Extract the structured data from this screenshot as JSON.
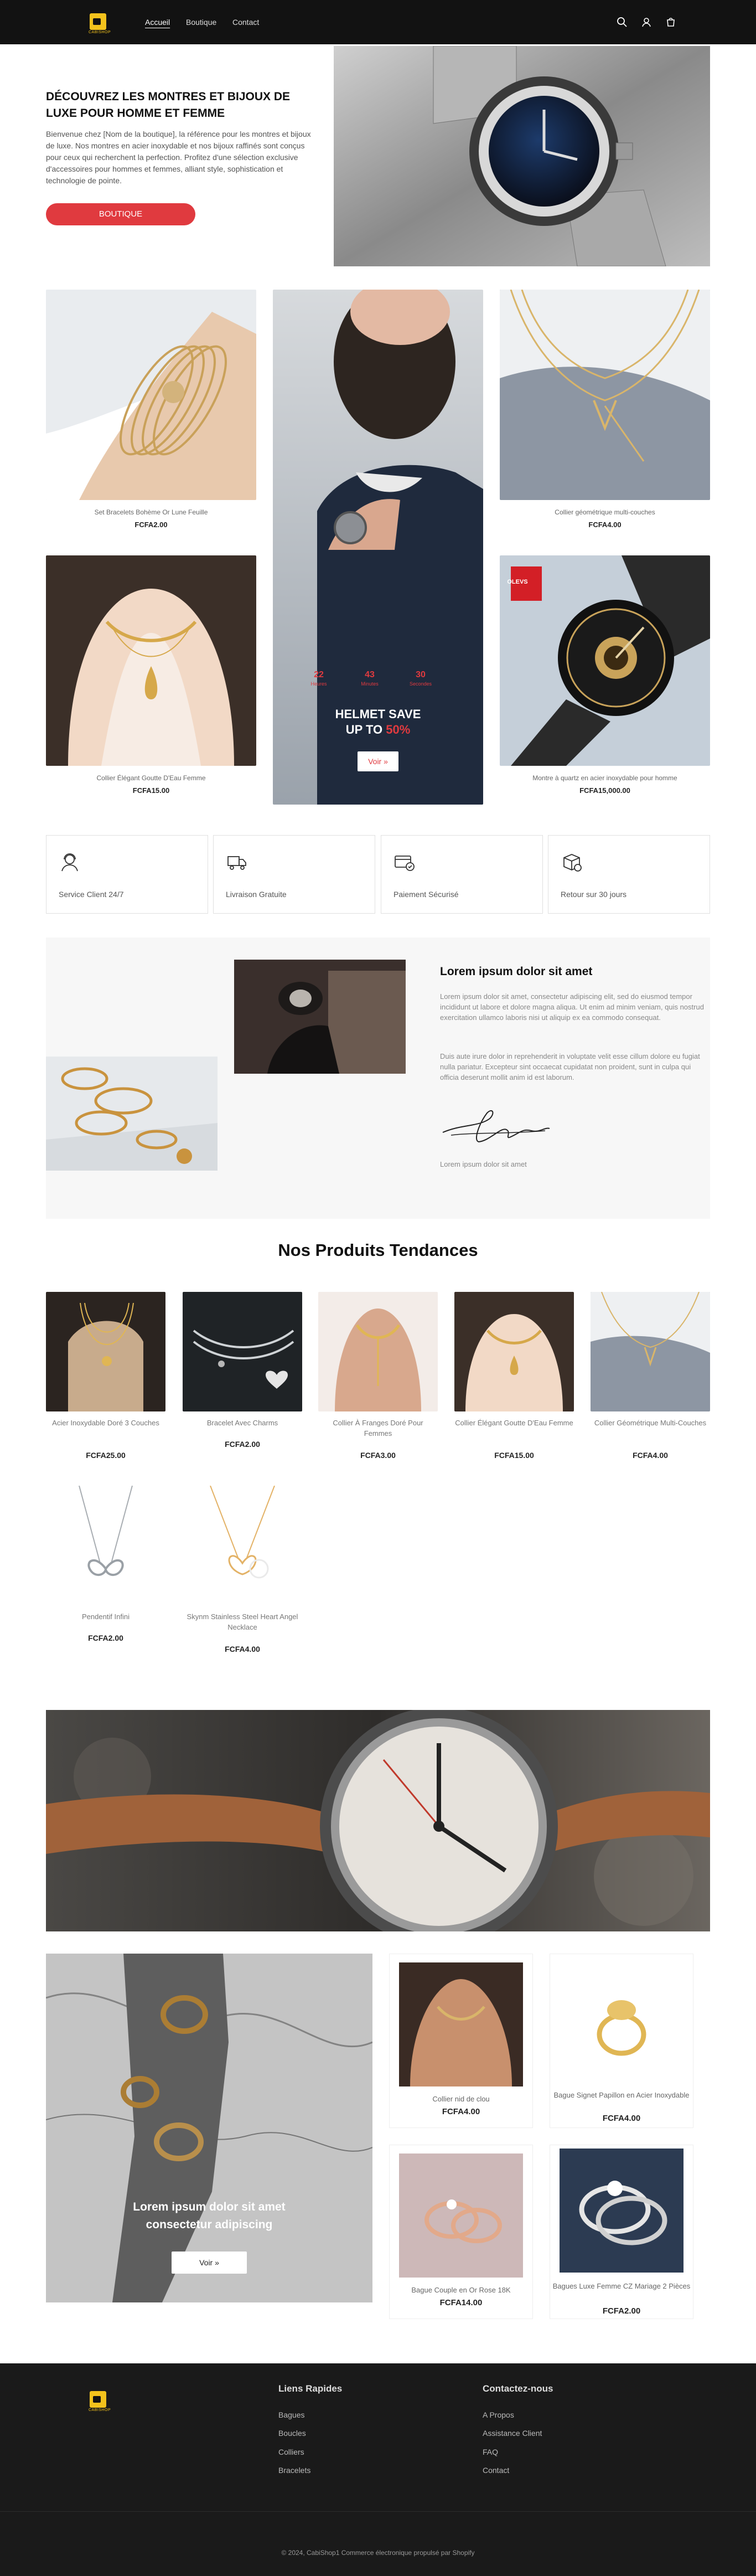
{
  "brand": {
    "logo_text": "CABISHOP"
  },
  "nav": {
    "items": [
      "Accueil",
      "Boutique",
      "Contact"
    ]
  },
  "hero": {
    "title": "DÉCOUVREZ LES MONTRES ET BIJOUX DE LUXE POUR HOMME ET FEMME",
    "text": "Bienvenue chez [Nom de la boutique], la référence pour les montres et bijoux de luxe. Nos montres en acier inoxydable et nos bijoux raffinés sont conçus pour ceux qui recherchent la perfection. Profitez d'une sélection exclusive d'accessoires pour hommes et femmes, alliant style, sophistication et technologie de pointe.",
    "button": "BOUTIQUE"
  },
  "collage": {
    "items": [
      {
        "title": "Set Bracelets Bohème Or Lune Feuille",
        "price": "FCFA2.00"
      },
      {
        "title": "Collier géométrique multi-couches",
        "price": "FCFA4.00"
      },
      {
        "title": "Collier Élégant Goutte D'Eau Femme",
        "price": "FCFA15.00"
      },
      {
        "title": "Montre à quartz en acier inoxydable pour homme",
        "price": "FCFA15,000.00"
      }
    ],
    "promo": {
      "countdown": [
        {
          "value": "22",
          "unit": "Heures"
        },
        {
          "value": "43",
          "unit": "Minutes"
        },
        {
          "value": "30",
          "unit": "Secondes"
        }
      ],
      "title_line1": "HELMET SAVE",
      "title_line2": "UP TO",
      "title_highlight": "50%",
      "button": "Voir »"
    },
    "badge_text": "OLEVS"
  },
  "features": [
    {
      "label": "Service Client 24/7",
      "icon": "headset-user-icon"
    },
    {
      "label": "Livraison Gratuite",
      "icon": "delivery-truck-icon"
    },
    {
      "label": "Paiement Sécurisé",
      "icon": "secure-payment-icon"
    },
    {
      "label": "Retour sur 30 jours",
      "icon": "return-box-icon"
    }
  ],
  "about": {
    "heading": "Lorem ipsum dolor sit amet",
    "p1": "Lorem ipsum dolor sit amet, consectetur adipiscing elit, sed do eiusmod tempor incididunt ut labore et dolore magna aliqua. Ut enim ad minim veniam, quis nostrud exercitation ullamco laboris nisi ut aliquip ex ea commodo consequat.",
    "p2": "Duis aute irure dolor in reprehenderit in voluptate velit esse cillum dolore eu fugiat nulla pariatur. Excepteur sint occaecat cupidatat non proident, sunt in culpa qui officia deserunt mollit anim id est laborum.",
    "signature_label": "Lorem ipsum dolor sit amet"
  },
  "trending": {
    "title": "Nos Produits Tendances",
    "items": [
      {
        "title": "Acier Inoxydable Doré 3 Couches",
        "price": "FCFA25.00"
      },
      {
        "title": "Bracelet Avec Charms",
        "price": "FCFA2.00"
      },
      {
        "title": "Collier À Franges Doré Pour Femmes",
        "price": "FCFA3.00"
      },
      {
        "title": "Collier Élégant Goutte D'Eau Femme",
        "price": "FCFA15.00"
      },
      {
        "title": "Collier Géométrique Multi-Couches",
        "price": "FCFA4.00"
      },
      {
        "title": "Pendentif Infini",
        "price": "FCFA2.00"
      },
      {
        "title": "Skynm Stainless Steel Heart Angel Necklace",
        "price": "FCFA4.00"
      }
    ]
  },
  "cta": {
    "line1": "Lorem ipsum dolor sit amet",
    "line2": "consectetur adipiscing",
    "button": "Voir »",
    "items": [
      {
        "title": "Collier nid de clou",
        "price": "FCFA4.00"
      },
      {
        "title": "Bague Signet Papillon en Acier Inoxydable",
        "price": "FCFA4.00"
      },
      {
        "title": "Bague Couple en Or Rose 18K",
        "price": "FCFA14.00"
      },
      {
        "title": "Bagues Luxe Femme CZ Mariage 2 Pièces",
        "price": "FCFA2.00"
      }
    ]
  },
  "footer": {
    "col1_title": "Liens Rapides",
    "col1_links": [
      "Bagues",
      "Boucles",
      "Colliers",
      "Bracelets"
    ],
    "col2_title": "Contactez-nous",
    "col2_links": [
      "A Propos",
      "Assistance Client",
      "FAQ",
      "Contact"
    ],
    "copyright": "© 2024, CabiShop1 Commerce électronique propulsé par Shopify"
  },
  "colors": {
    "accent": "#e03a3f",
    "brand_yellow": "#f3c21c",
    "header_bg": "#121212",
    "footer_bg": "#1a1a1a"
  }
}
